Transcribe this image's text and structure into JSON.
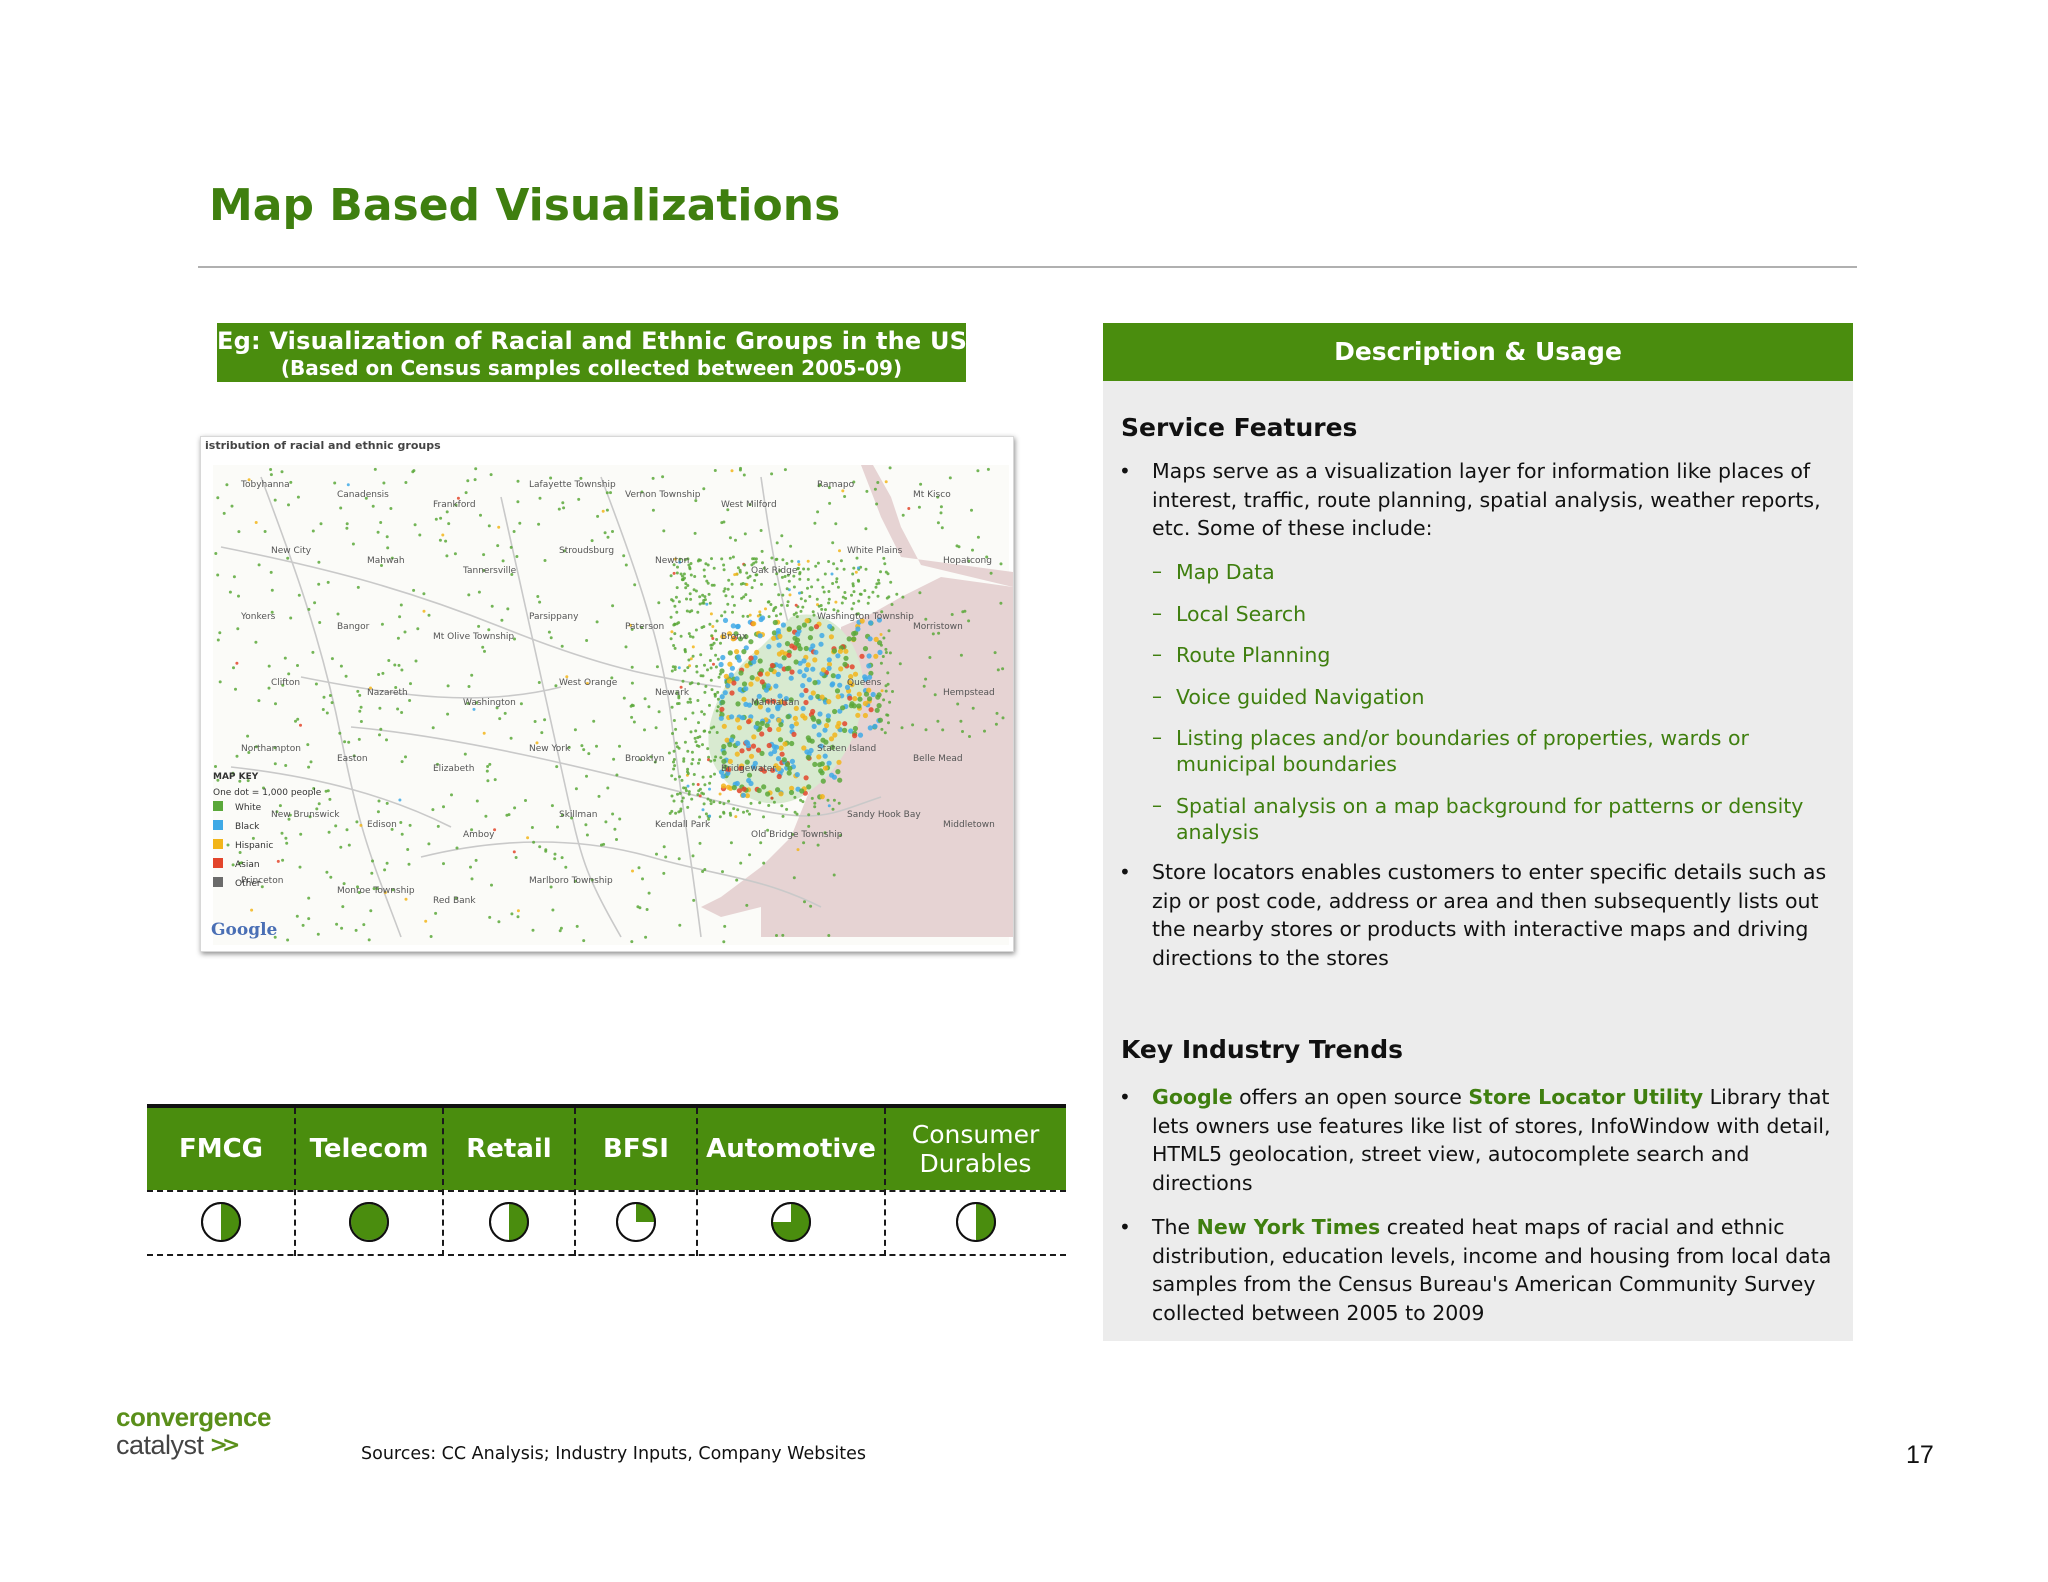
{
  "title": "Map Based Visualizations",
  "example": {
    "caption_line1": "Eg: Visualization of Racial and Ethnic Groups in the US",
    "caption_line2": "(Based on Census samples collected between 2005-09)"
  },
  "map": {
    "heading_partial": "istribution of racial and ethnic groups",
    "key_title": "MAP KEY",
    "key_scale": "One dot = 1,000 people",
    "key_items": [
      {
        "label": "White",
        "color": "#5aa83a"
      },
      {
        "label": "Black",
        "color": "#3fa9e6"
      },
      {
        "label": "Hispanic",
        "color": "#f2b51a"
      },
      {
        "label": "Asian",
        "color": "#e3452c"
      },
      {
        "label": "Other",
        "color": "#6b6b6b"
      }
    ],
    "place_labels": [
      "Tobyhanna",
      "Canadensis",
      "Frankford",
      "Lafayette Township",
      "Vernon Township",
      "West Milford",
      "Ramapo",
      "Mt Kisco",
      "New City",
      "Mahwah",
      "Tannersville",
      "Stroudsburg",
      "Newton",
      "Oak Ridge",
      "White Plains",
      "Hopatcong",
      "Yonkers",
      "Bangor",
      "Mt Olive Township",
      "Parsippany",
      "Paterson",
      "Bronx",
      "Washington Township",
      "Morristown",
      "Clifton",
      "Nazareth",
      "Washington",
      "West Orange",
      "Newark",
      "Manhattan",
      "Queens",
      "Hempstead",
      "Northampton",
      "Easton",
      "Elizabeth",
      "New York",
      "Brooklyn",
      "Bridgewater",
      "Staten Island",
      "Belle Mead",
      "New Brunswick",
      "Edison",
      "Amboy",
      "Skillman",
      "Kendall Park",
      "Old Bridge Township",
      "Sandy Hook Bay",
      "Middletown",
      "Princeton",
      "Monroe Township",
      "Red Bank",
      "Marlboro Township"
    ],
    "logo_text": "Google"
  },
  "description": {
    "header": "Description & Usage",
    "service_features": {
      "heading": "Service Features",
      "intro": "Maps serve as a visualization layer for information like places of interest, traffic, route planning, spatial analysis, weather reports, etc. Some of these include:",
      "items": [
        "Map Data",
        "Local Search",
        "Route Planning",
        "Voice guided Navigation",
        "Listing places and/or boundaries of properties, wards or municipal boundaries",
        "Spatial analysis on a map background for patterns or density analysis"
      ],
      "store_locators": "Store locators enables customers to enter specific details such as zip or post code, address or area and then subsequently lists out the nearby stores or products with interactive maps and driving directions to the stores"
    },
    "key_trends": {
      "heading": "Key Industry Trends",
      "google": {
        "brand": "Google",
        "text1": " offers an open source ",
        "utility": "Store Locator Utility",
        "text2": " Library that lets owners use features like list of stores, InfoWindow with detail, HTML5 geolocation, street view, autocomplete search and directions"
      },
      "nyt": {
        "text1": "The ",
        "brand": "New York Times",
        "text2": " created heat maps of racial and ethnic distribution, education levels, income and housing from local data samples from the Census Bureau's American Community Survey collected between 2005 to 2009"
      }
    }
  },
  "industries": [
    {
      "name": "FMCG",
      "relevance": 0.5
    },
    {
      "name": "Telecom",
      "relevance": 1.0
    },
    {
      "name": "Retail",
      "relevance": 0.5
    },
    {
      "name": "BFSI",
      "relevance": 0.25
    },
    {
      "name": "Automotive",
      "relevance": 0.75
    },
    {
      "name": "Consumer Durables",
      "relevance": 0.5
    }
  ],
  "colors": {
    "brand_green": "#4a8d0e",
    "title_green": "#3f7f0f",
    "panel_bg": "#ececec"
  },
  "footer": {
    "logo_line1": "convergence",
    "logo_line2": "catalyst",
    "sources": "Sources: CC Analysis; Industry Inputs, Company Websites",
    "page_number": "17"
  }
}
